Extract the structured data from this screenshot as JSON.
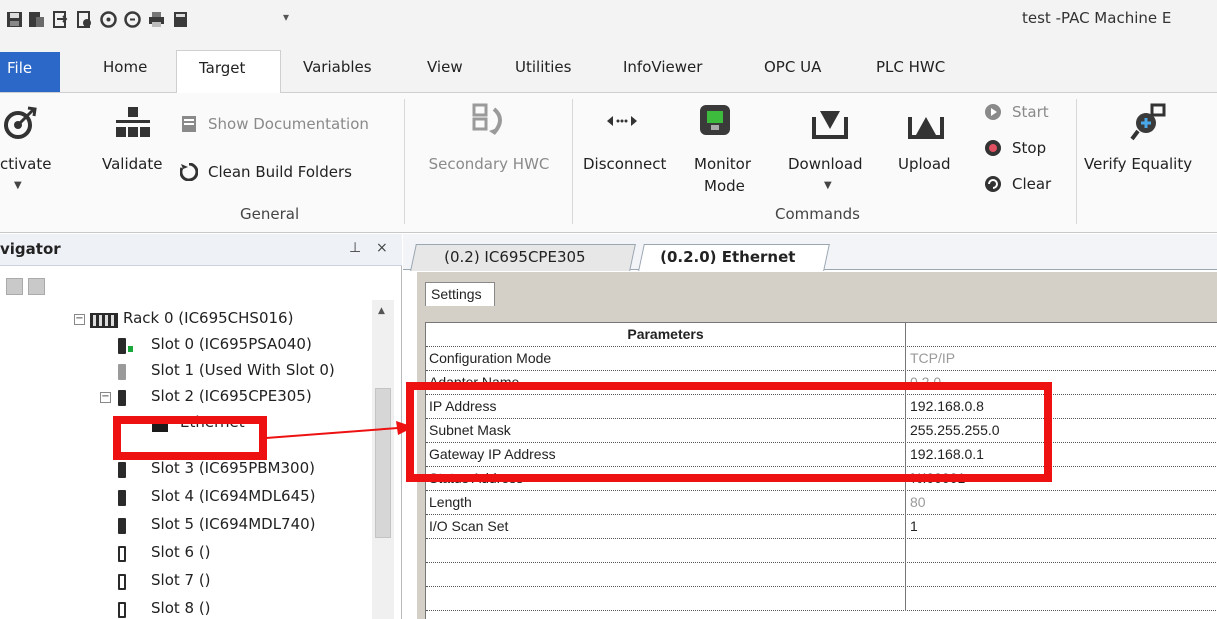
{
  "window": {
    "title": "test -PAC Machine E"
  },
  "ribbon_tabs": [
    {
      "label": "File"
    },
    {
      "label": "Home"
    },
    {
      "label": "Target"
    },
    {
      "label": "Variables"
    },
    {
      "label": "View"
    },
    {
      "label": "Utilities"
    },
    {
      "label": "InfoViewer"
    },
    {
      "label": "OPC UA"
    },
    {
      "label": "PLC HWC"
    }
  ],
  "ribbon": {
    "activate": "ctivate",
    "validate": "Validate",
    "show_documentation": "Show Documentation",
    "clean_build_folders": "Clean Build Folders",
    "secondary_hwc": "Secondary HWC",
    "disconnect": "Disconnect",
    "monitor_mode_line1": "Monitor",
    "monitor_mode_line2": "Mode",
    "download": "Download",
    "upload": "Upload",
    "start": "Start",
    "stop": "Stop",
    "clear": "Clear",
    "verify_equality": "Verify Equality",
    "group_general": "General",
    "group_commands": "Commands"
  },
  "navigator": {
    "title": "vigator",
    "pin": "⊥",
    "close": "×",
    "tree": [
      {
        "label": "Rack 0 (IC695CHS016)"
      },
      {
        "label": "Slot 0 (IC695PSA040)"
      },
      {
        "label": "Slot 1 (Used With Slot 0)"
      },
      {
        "label": "Slot 2 (IC695CPE305)"
      },
      {
        "label": "Ethernet"
      },
      {
        "label": "Slot 3 (IC695PBM300)"
      },
      {
        "label": "Slot 4 (IC694MDL645)"
      },
      {
        "label": "Slot 5 (IC694MDL740)"
      },
      {
        "label": "Slot 6 ()"
      },
      {
        "label": "Slot 7 ()"
      },
      {
        "label": "Slot 8 ()"
      }
    ]
  },
  "editor": {
    "tabs": [
      {
        "label": "(0.2) IC695CPE305"
      },
      {
        "label": "(0.2.0) Ethernet"
      }
    ],
    "settings_tab": "Settings",
    "grid_header": "Parameters",
    "rows": [
      {
        "name": "Configuration Mode",
        "value": "TCP/IP"
      },
      {
        "name": "Adapter Name",
        "value": "0.2.0"
      },
      {
        "name": "IP Address",
        "value": "192.168.0.8"
      },
      {
        "name": "Subnet Mask",
        "value": "255.255.255.0"
      },
      {
        "name": "Gateway IP Address",
        "value": "192.168.0.1"
      },
      {
        "name": "Status Address",
        "value": "%I00001"
      },
      {
        "name": "Length",
        "value": "80"
      },
      {
        "name": "I/O Scan Set",
        "value": "1"
      }
    ]
  },
  "colors": {
    "file_tab": "#2c68c8",
    "highlight": "#ee1111",
    "status_green": "#1aa83a"
  }
}
